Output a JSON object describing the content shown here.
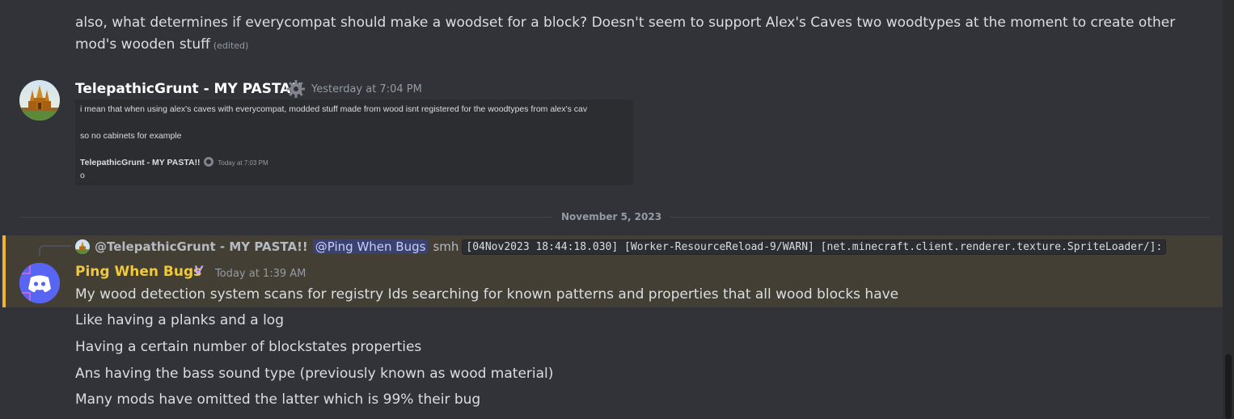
{
  "messages": {
    "first": {
      "line1": "also, what determines if everycompat should make a woodset for a block? Doesn't seem to support Alex's Caves two woodtypes at the moment to create other",
      "line2": "mod's wooden stuff",
      "edited": "(edited)"
    },
    "second": {
      "author": "TelepathicGrunt - MY PASTA!!",
      "author_color": "#ffffff",
      "timestamp": "Yesterday at 7:04 PM",
      "attachment": {
        "line1": "i mean that when using alex's caves with everycompat, modded stuff made from wood isnt registered for the woodtypes from alex's cav",
        "line2": "so no cabinets for example",
        "author": "TelepathicGrunt - MY PASTA!!",
        "timestamp": "Today at 7:03 PM",
        "line3": "o"
      }
    },
    "divider": "November 5, 2023",
    "third": {
      "reply": {
        "author": "@TelepathicGrunt - MY PASTA!!",
        "mention": "@Ping When Bugs",
        "text": "smh",
        "code": "[04Nov2023 18:44:18.030] [Worker-ResourceReload-9/WARN] [net.minecraft.client.renderer.texture.SpriteLoader/]:"
      },
      "author": "Ping When Bugs",
      "author_color": "#f0c93a",
      "badge": "V",
      "timestamp": "Today at 1:39 AM",
      "lines": [
        "My wood detection system scans for registry Ids searching for known patterns and properties that all wood blocks have",
        "Like having a planks and a log",
        "Having a certain number of blockstates properties",
        "Ans having the bass sound type (previously known as wood material)",
        "Many mods have omitted the latter which is 99% their bug"
      ]
    }
  },
  "icons": {
    "gear": "gear-icon",
    "discord": "discord-logo-icon",
    "temple": "temple-avatar"
  },
  "colors": {
    "background": "#313338",
    "highlight": "#433f35",
    "highlight_bar": "#f0b232",
    "mention_bg": "#3c4270"
  }
}
